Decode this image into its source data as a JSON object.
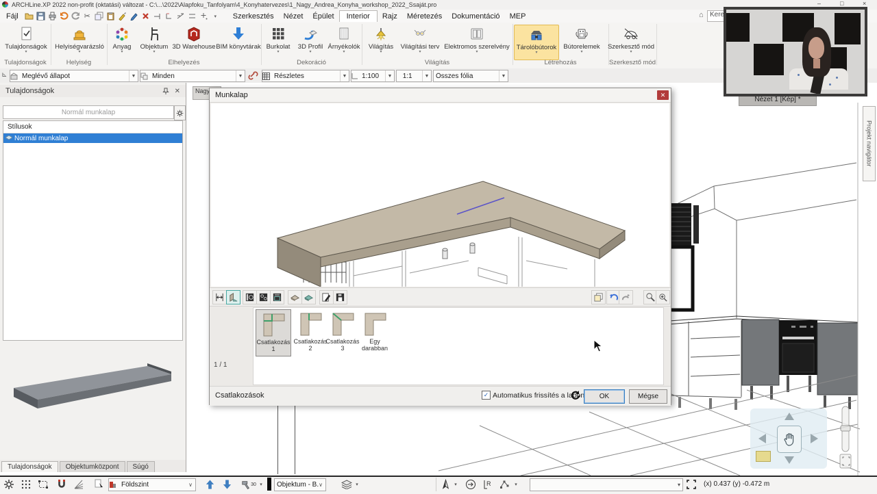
{
  "window": {
    "title": "ARCHLine.XP 2022 non-profit (oktatási) változat - C:\\...\\2022\\Alapfoku_Tanfolyam\\4_Konyhatervezes\\1_Nagy_Andrea_Konyha_workshop_2022_Ssaját.pro",
    "controls": {
      "minimize": "–",
      "maximize": "□",
      "close": "×"
    }
  },
  "menubar": {
    "file": "Fájl",
    "items": [
      {
        "label": "Szerkesztés"
      },
      {
        "label": "Nézet"
      },
      {
        "label": "Épület"
      },
      {
        "label": "Interior"
      },
      {
        "label": "Rajz"
      },
      {
        "label": "Méretezés"
      },
      {
        "label": "Dokumentáció"
      },
      {
        "label": "MEP"
      }
    ],
    "active_item": "Interior",
    "search_value": "Keresés",
    "home_icon": "⌂"
  },
  "ribbon": {
    "buttons": [
      {
        "label": "Tulajdonságok",
        "icon": "properties-doc-icon"
      },
      {
        "label": "Helyiségvarázsló",
        "icon": "room-wizard-icon"
      },
      {
        "label": "Anyag",
        "icon": "material-wheel-icon"
      },
      {
        "label": "Objektum",
        "icon": "chair-object-icon"
      },
      {
        "label": "3D Warehouse",
        "icon": "3dwarehouse-icon"
      },
      {
        "label": "BIM könyvtárak",
        "icon": "bim-download-icon"
      },
      {
        "label": "Burkolat",
        "icon": "tiling-grid-icon"
      },
      {
        "label": "3D Profil",
        "icon": "3d-profile-icon"
      },
      {
        "label": "Árnyékolók",
        "icon": "shading-curtain-icon"
      },
      {
        "label": "Világítás",
        "icon": "lamp-icon"
      },
      {
        "label": "Világítási terv",
        "icon": "light-plan-icon"
      },
      {
        "label": "Elektromos szerelvény",
        "icon": "switch-icon"
      },
      {
        "label": "Tárolóbútorok",
        "icon": "cabinet-hood-icon",
        "active": true
      },
      {
        "label": "Bútorelemek",
        "icon": "furniture-parts-icon"
      },
      {
        "label": "Szerkesztő mód",
        "icon": "edit-mode-icon"
      }
    ],
    "groups": [
      {
        "label": "Tulajdonságok"
      },
      {
        "label": "Helyiség"
      },
      {
        "label": "Elhelyezés"
      },
      {
        "label": "Dekoráció"
      },
      {
        "label": "Világítás"
      },
      {
        "label": "Létrehozás"
      },
      {
        "label": "Szerkesztő mód"
      }
    ],
    "highlight_color": "#fbe3a0"
  },
  "quickbar": {
    "state_combo": "Meglévő állapot",
    "filter_combo": "Minden",
    "detail_combo": "Részletes",
    "scale_combo": "1:100",
    "ratio_combo": "1:1",
    "layer_combo": "Összes fólia"
  },
  "left_panel": {
    "title": "Tulajdonságok",
    "style_selector": "Normál munkalap",
    "list_header": "Stílusok",
    "styles": [
      {
        "label": "Normál munkalap",
        "selected": true
      }
    ],
    "tabs": [
      {
        "label": "Tulajdonságok",
        "active": true
      },
      {
        "label": "Objektumközpont"
      },
      {
        "label": "Súgó"
      }
    ],
    "selection_color": "#2f7fd4"
  },
  "plan_window": {
    "tab": "Nagy"
  },
  "dialog": {
    "title": "Munkalap",
    "page_indicator": "1 / 1",
    "thumbnails": [
      {
        "label": "Csatlakozás 1",
        "selected": true
      },
      {
        "label": "Csatlakozás 2"
      },
      {
        "label": "Csatlakozás 3"
      },
      {
        "label": "Egy darabban"
      }
    ],
    "footer_label": "Csatlakozások",
    "auto_refresh_label": "Automatikus frissítés a lapon",
    "auto_refresh_checked": true,
    "ok_label": "OK",
    "cancel_label": "Mégse",
    "seam_color": "#5b54c8",
    "worktop_color": "#c3b9a7"
  },
  "view_window": {
    "tab": "Nézet 1 [Kép] *",
    "side_tab": "Projekt navigátor"
  },
  "statusbar": {
    "floor_combo": "Földszint",
    "snap_angle": "30",
    "tool_combo": "Objektum - B...",
    "coordinates": "(x) 0.437   (y) -0.472 m",
    "arrow_color": "#3f7fc1"
  }
}
